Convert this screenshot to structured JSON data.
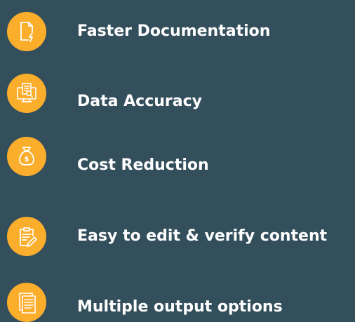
{
  "features": [
    {
      "icon": "document-lightning-icon",
      "label": "Faster Documentation"
    },
    {
      "icon": "monitor-document-search-icon",
      "label": "Data Accuracy"
    },
    {
      "icon": "money-bag-dollar-icon",
      "label": "Cost Reduction"
    },
    {
      "icon": "clipboard-pencil-icon",
      "label": "Easy to edit & verify content"
    },
    {
      "icon": "stacked-documents-icon",
      "label": "Multiple output options"
    }
  ],
  "colors": {
    "background": "#344f5c",
    "badge": "#fbad2c",
    "text": "#ffffff",
    "icon_stroke": "#ffffff"
  }
}
